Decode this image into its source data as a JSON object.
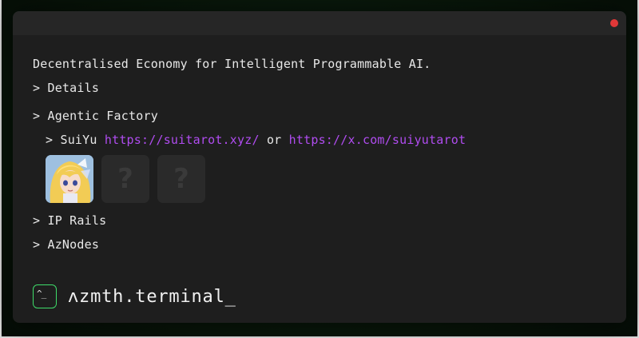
{
  "window": {
    "close_color": "#e03838"
  },
  "terminal": {
    "tagline": "Decentralised Economy for Intelligent Programmable AI.",
    "details_label": "> Details",
    "agentic_label": "> Agentic Factory",
    "suiyu_prefix": "> SuiYu",
    "suiyu_link1": "https://suitarot.xyz/",
    "suiyu_or": "or",
    "suiyu_link2": "https://x.com/suiyutarot",
    "tiles": [
      {
        "kind": "avatar"
      },
      {
        "label": "?"
      },
      {
        "label": "?"
      }
    ],
    "ip_rails_label": "> IP Rails",
    "aznodes_label": "> AzNodes"
  },
  "brand": {
    "icon_glyph": "^_",
    "name": "ʌzmth.terminal_"
  },
  "colors": {
    "accent_link": "#b04cf0",
    "prompt_border": "#3fdc6a",
    "background": "#1e1e1e"
  }
}
